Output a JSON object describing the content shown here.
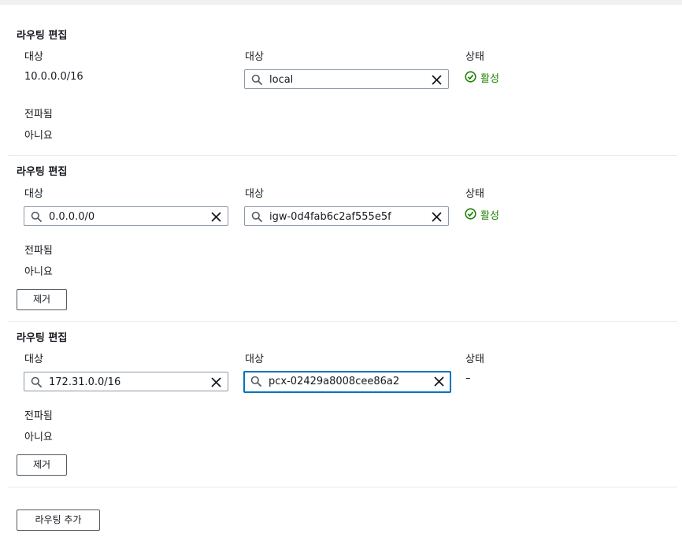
{
  "routes": [
    {
      "title": "라우팅 편집",
      "destination_label": "대상",
      "destination_value": "10.0.0.0/16",
      "target_label": "대상",
      "target_value": "local",
      "status_label": "상태",
      "status_value": "활성",
      "propagated_label": "전파됨",
      "propagated_value": "아니요"
    },
    {
      "title": "라우팅 편집",
      "destination_label": "대상",
      "destination_value": "0.0.0.0/0",
      "target_label": "대상",
      "target_value": "igw-0d4fab6c2af555e5f",
      "status_label": "상태",
      "status_value": "활성",
      "propagated_label": "전파됨",
      "propagated_value": "아니요",
      "remove_label": "제거"
    },
    {
      "title": "라우팅 편집",
      "destination_label": "대상",
      "destination_value": "172.31.0.0/16",
      "target_label": "대상",
      "target_value": "pcx-02429a8008cee86a2",
      "status_label": "상태",
      "status_value": "–",
      "propagated_label": "전파됨",
      "propagated_value": "아니요",
      "remove_label": "제거"
    }
  ],
  "add_route_label": "라우팅 추가",
  "colors": {
    "active_status": "#1d8102",
    "focus_border": "#0073bb",
    "input_border": "#8d99a8"
  },
  "icons": [
    "search-icon",
    "clear-icon",
    "check-circle-icon"
  ]
}
